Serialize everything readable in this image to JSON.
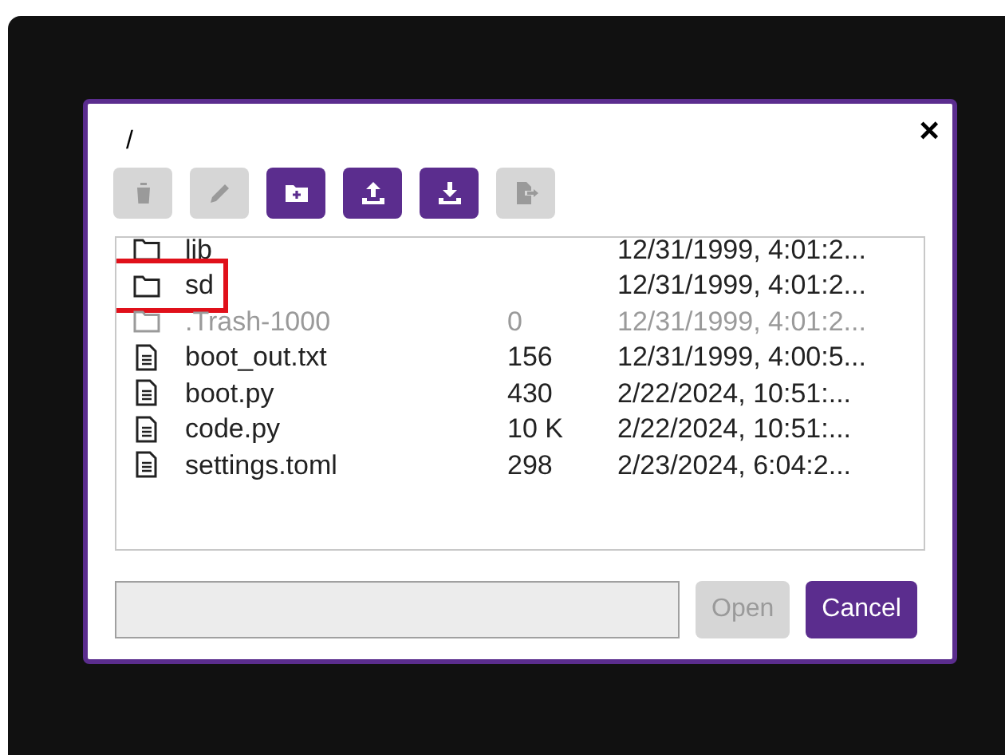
{
  "dialog": {
    "path": "/",
    "close": "×"
  },
  "toolbar": [
    {
      "kind": "delete",
      "disabled": true
    },
    {
      "kind": "rename",
      "disabled": true
    },
    {
      "kind": "new-folder",
      "disabled": false
    },
    {
      "kind": "upload",
      "disabled": false
    },
    {
      "kind": "download",
      "disabled": false
    },
    {
      "kind": "move",
      "disabled": true
    }
  ],
  "files": [
    {
      "kind": "folder",
      "name": "lib",
      "modified": "12/31/1999, 4:01:2...",
      "dimmed": false,
      "highlighted": false
    },
    {
      "kind": "folder",
      "name": "sd",
      "modified": "12/31/1999, 4:01:2...",
      "dimmed": false,
      "highlighted": true
    },
    {
      "kind": "folder",
      "name": ".Trash-1000",
      "size": "0",
      "modified": "12/31/1999, 4:01:2...",
      "dimmed": true,
      "highlighted": false
    },
    {
      "kind": "file",
      "name": "boot_out.txt",
      "size": "156",
      "modified": "12/31/1999, 4:00:5...",
      "dimmed": false,
      "highlighted": false
    },
    {
      "kind": "file",
      "name": "boot.py",
      "size": "430",
      "modified": "2/22/2024, 10:51:...",
      "dimmed": false,
      "highlighted": false
    },
    {
      "kind": "file",
      "name": "code.py",
      "size": "10 K",
      "modified": "2/22/2024, 10:51:...",
      "dimmed": false,
      "highlighted": false
    },
    {
      "kind": "file",
      "name": "settings.toml",
      "size": "298",
      "modified": "2/23/2024, 6:04:2...",
      "dimmed": false,
      "highlighted": false
    }
  ],
  "filename_field": {
    "disabled": true
  },
  "buttons": [
    {
      "label": "Open",
      "disabled": true
    },
    {
      "label": "Cancel",
      "disabled": false
    }
  ]
}
